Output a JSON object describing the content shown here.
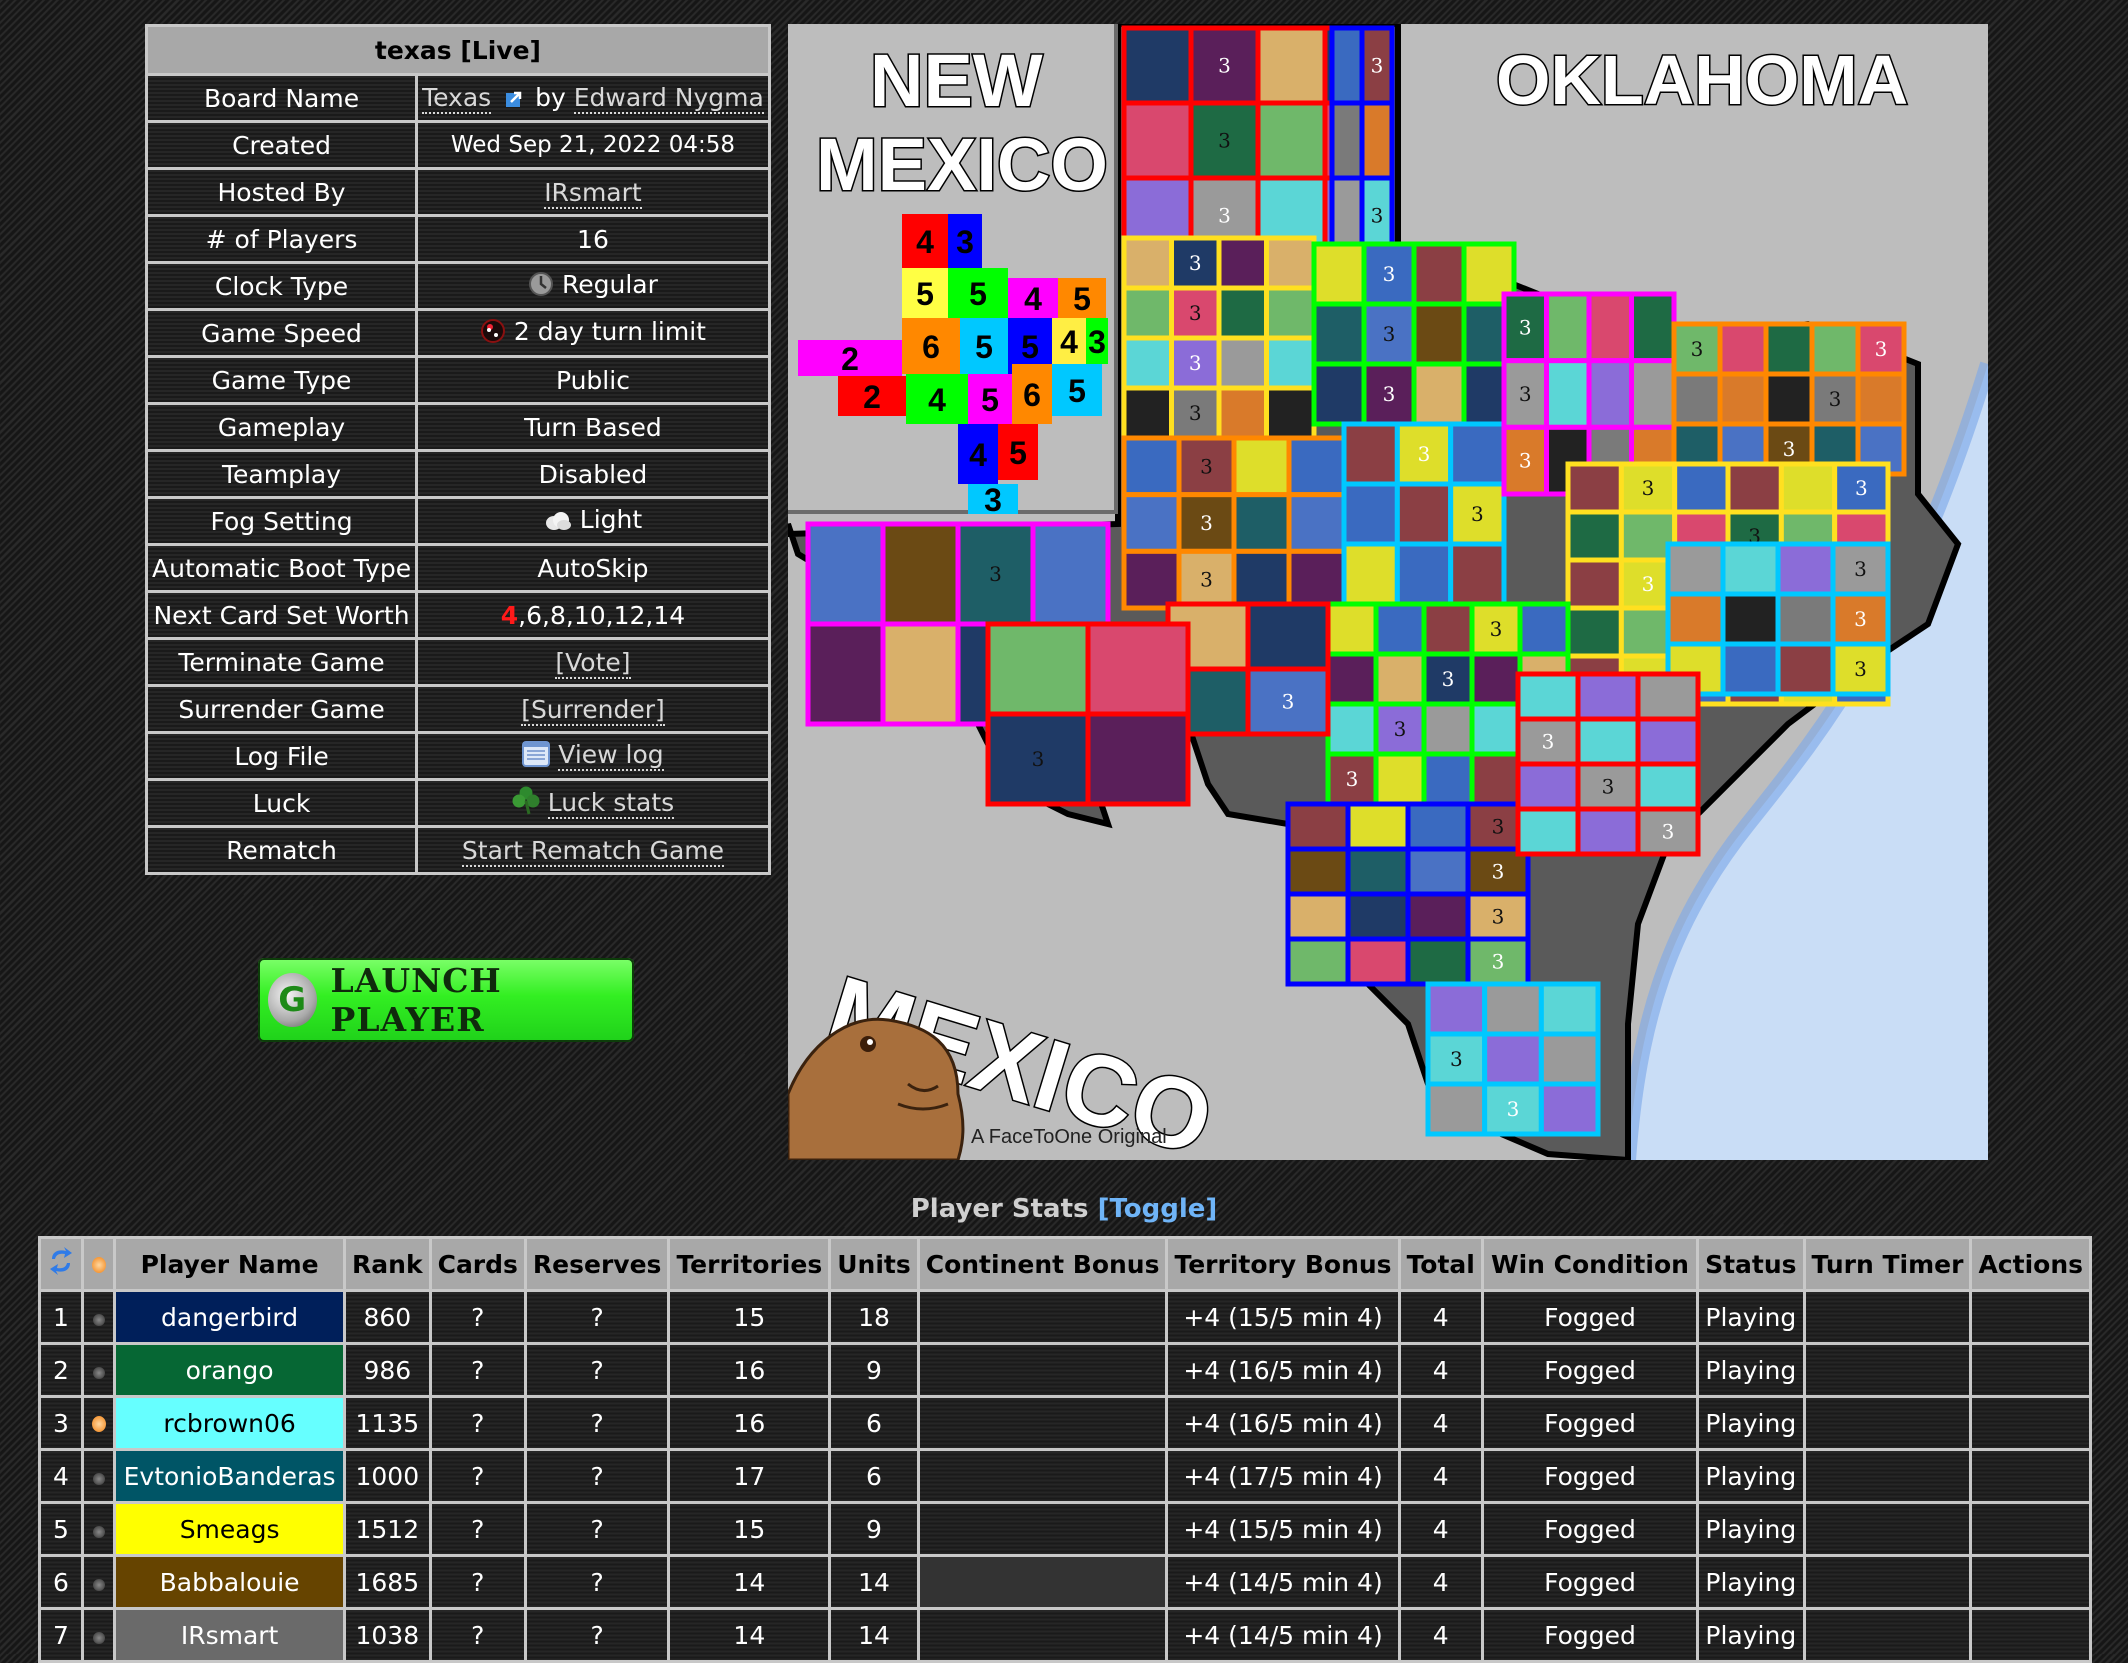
{
  "info": {
    "title": "texas [Live]",
    "rows": [
      {
        "label": "Board Name",
        "board": "Texas",
        "by": "by",
        "author": "Edward Nygma"
      },
      {
        "label": "Created",
        "value": "Wed Sep 21, 2022 04:58"
      },
      {
        "label": "Hosted By",
        "value": "IRsmart"
      },
      {
        "label": "# of Players",
        "value": "16"
      },
      {
        "label": "Clock Type",
        "value": "Regular",
        "icon": "clock-icon"
      },
      {
        "label": "Game Speed",
        "value": "2 day turn limit",
        "icon": "speed-ball-icon"
      },
      {
        "label": "Game Type",
        "value": "Public"
      },
      {
        "label": "Gameplay",
        "value": "Turn Based"
      },
      {
        "label": "Teamplay",
        "value": "Disabled"
      },
      {
        "label": "Fog Setting",
        "value": "Light",
        "icon": "fog-cloud-icon"
      },
      {
        "label": "Automatic Boot Type",
        "value": "AutoSkip"
      },
      {
        "label": "Next Card Set Worth",
        "current": "4",
        "rest": ",6,8,10,12,14"
      },
      {
        "label": "Terminate Game",
        "value": "[Vote]"
      },
      {
        "label": "Surrender Game",
        "value": "[Surrender]"
      },
      {
        "label": "Log File",
        "value": "View log",
        "icon": "log-file-icon"
      },
      {
        "label": "Luck",
        "value": "Luck stats",
        "icon": "clover-icon"
      },
      {
        "label": "Rematch",
        "value": "Start Rematch Game"
      }
    ]
  },
  "launch_button": {
    "label": "LAUNCH PLAYER",
    "icon_letter": "G"
  },
  "map": {
    "labels": {
      "new_mexico_1": "NEW",
      "new_mexico_2": "MEXICO",
      "oklahoma": "OKLAHOMA",
      "mexico": "MEXICO"
    },
    "attribution": "A FaceToOne Original",
    "legend_values": [
      "4",
      "3",
      "5",
      "5",
      "4",
      "5",
      "6",
      "5",
      "5",
      "4",
      "3",
      "2",
      "2",
      "4",
      "5",
      "6",
      "5",
      "5",
      "4",
      "3"
    ],
    "colors": {
      "gulf": "#c9ddf6",
      "land_bg": "#bdbdbd"
    }
  },
  "player_stats": {
    "title": "Player Stats",
    "toggle": "[Toggle]",
    "columns": [
      "",
      "",
      "Player Name",
      "Rank",
      "Cards",
      "Reserves",
      "Territories",
      "Units",
      "Continent Bonus",
      "Territory Bonus",
      "Total",
      "Win Condition",
      "Status",
      "Turn Timer",
      "Actions"
    ],
    "rows": [
      {
        "num": "1",
        "active": false,
        "name": "dangerbird",
        "color": "#001f5a",
        "text_color": "#ffffff",
        "rank": "860",
        "cards": "?",
        "reserves": "?",
        "territories": "15",
        "units": "18",
        "continent_bonus": "",
        "territory_bonus": "+4 (15/5 min 4)",
        "total": "4",
        "win_condition": "Fogged",
        "status": "Playing",
        "turn_timer": "",
        "actions": ""
      },
      {
        "num": "2",
        "active": false,
        "name": "orango",
        "color": "#066734",
        "text_color": "#ffffff",
        "rank": "986",
        "cards": "?",
        "reserves": "?",
        "territories": "16",
        "units": "9",
        "continent_bonus": "",
        "territory_bonus": "+4 (16/5 min 4)",
        "total": "4",
        "win_condition": "Fogged",
        "status": "Playing",
        "turn_timer": "",
        "actions": ""
      },
      {
        "num": "3",
        "active": true,
        "name": "rcbrown06",
        "color": "#66ffff",
        "text_color": "#000000",
        "rank": "1135",
        "cards": "?",
        "reserves": "?",
        "territories": "16",
        "units": "6",
        "continent_bonus": "",
        "territory_bonus": "+4 (16/5 min 4)",
        "total": "4",
        "win_condition": "Fogged",
        "status": "Playing",
        "turn_timer": "",
        "actions": ""
      },
      {
        "num": "4",
        "active": false,
        "name": "EvtonioBanderas",
        "color": "#005566",
        "text_color": "#ffffff",
        "rank": "1000",
        "cards": "?",
        "reserves": "?",
        "territories": "17",
        "units": "6",
        "continent_bonus": "",
        "territory_bonus": "+4 (17/5 min 4)",
        "total": "4",
        "win_condition": "Fogged",
        "status": "Playing",
        "turn_timer": "",
        "actions": ""
      },
      {
        "num": "5",
        "active": false,
        "name": "Smeags",
        "color": "#ffff00",
        "text_color": "#000000",
        "rank": "1512",
        "cards": "?",
        "reserves": "?",
        "territories": "15",
        "units": "9",
        "continent_bonus": "",
        "territory_bonus": "+4 (15/5 min 4)",
        "total": "4",
        "win_condition": "Fogged",
        "status": "Playing",
        "turn_timer": "",
        "actions": ""
      },
      {
        "num": "6",
        "active": false,
        "name": "Babbalouie",
        "color": "#664400",
        "text_color": "#ffffff",
        "rank": "1685",
        "cards": "?",
        "reserves": "?",
        "territories": "14",
        "units": "14",
        "continent_bonus": "",
        "continent_dark": true,
        "territory_bonus": "+4 (14/5 min 4)",
        "total": "4",
        "win_condition": "Fogged",
        "status": "Playing",
        "turn_timer": "",
        "actions": ""
      },
      {
        "num": "7",
        "active": false,
        "name": "IRsmart",
        "color": "#6a6a6a",
        "text_color": "#ffffff",
        "rank": "1038",
        "cards": "?",
        "reserves": "?",
        "territories": "14",
        "units": "14",
        "continent_bonus": "",
        "territory_bonus": "+4 (14/5 min 4)",
        "total": "4",
        "win_condition": "Fogged",
        "status": "Playing",
        "turn_timer": "",
        "actions": ""
      }
    ]
  }
}
